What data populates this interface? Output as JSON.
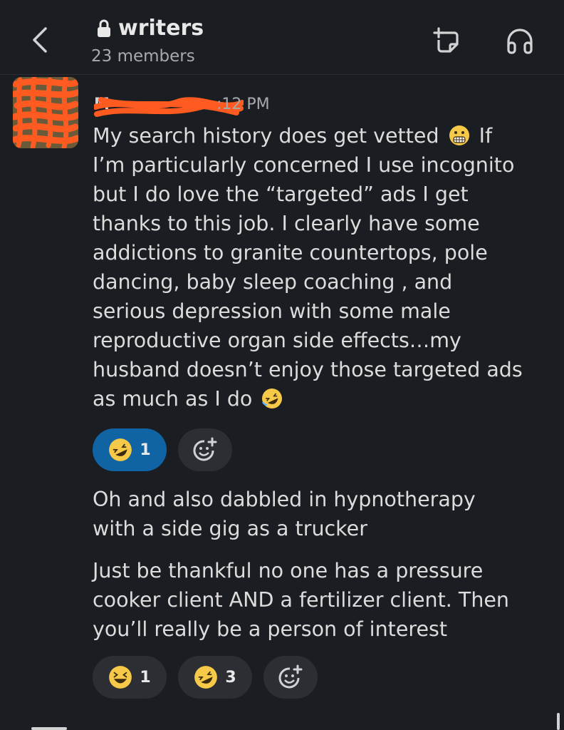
{
  "header": {
    "channel_name": "writers",
    "member_count": "23 members"
  },
  "message": {
    "sender_name": "M",
    "time": ":12 PM",
    "body1_lines": [
      "My search history does get vetted",
      "I’m particularly concerned I use incognito",
      "but I do love the “targeted” ads I get",
      "thanks to this job. I clearly have some",
      "addictions to granite countertops, pole",
      "dancing, baby sleep coaching , and",
      "serious depression with some male",
      "reproductive organ side effects…my",
      "husband doesn’t enjoy those targeted ads",
      "as much as I do"
    ],
    "body1_line1_suffix": "If",
    "body2_lines": [
      "Oh and also dabbled in hypnotherapy",
      "with a side gig as a trucker"
    ],
    "body3_lines": [
      "Just be thankful no one has a pressure",
      "cooker client AND a fertilizer client. Then",
      "you’ll really be a person of interest"
    ]
  },
  "reactions_1": [
    {
      "emoji": "rofl-emoji",
      "count": "1",
      "mine": true
    }
  ],
  "reactions_2": [
    {
      "emoji": "laughing-emoji",
      "count": "1",
      "mine": false
    },
    {
      "emoji": "rofl-emoji",
      "count": "3",
      "mine": false
    }
  ],
  "colors": {
    "background": "#1a1d21",
    "pill": "#2c2e33",
    "pill_selected": "#1164a3",
    "scribble": "#ff5a1f"
  }
}
